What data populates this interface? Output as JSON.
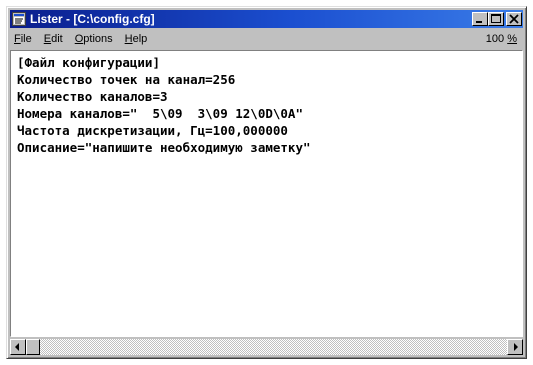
{
  "window": {
    "title": "Lister - [C:\\config.cfg]"
  },
  "menu": {
    "items": [
      {
        "accel": "F",
        "rest": "ile"
      },
      {
        "accel": "E",
        "rest": "dit"
      },
      {
        "accel": "O",
        "rest": "ptions"
      },
      {
        "accel": "H",
        "rest": "elp"
      }
    ],
    "zoom_value": "100 ",
    "zoom_unit": "%"
  },
  "content": {
    "lines": [
      "[Файл конфигурации]",
      "Количество точек на канал=256",
      "Количество каналов=3",
      "Номера каналов=\"  5\\09  3\\09 12\\0D\\0A\"",
      "Частота дискретизации, Гц=100,000000",
      "Описание=\"напишите необходимую заметку\""
    ]
  },
  "colors": {
    "titlebar_start": "#0a1d8c",
    "titlebar_end": "#3a7ce8",
    "chrome": "#c0c0c0"
  },
  "icons": {
    "app": "lister-app-icon",
    "minimize": "minimize-icon",
    "maximize": "maximize-icon",
    "close": "close-icon",
    "scroll_left": "arrow-left-icon",
    "scroll_right": "arrow-right-icon"
  }
}
